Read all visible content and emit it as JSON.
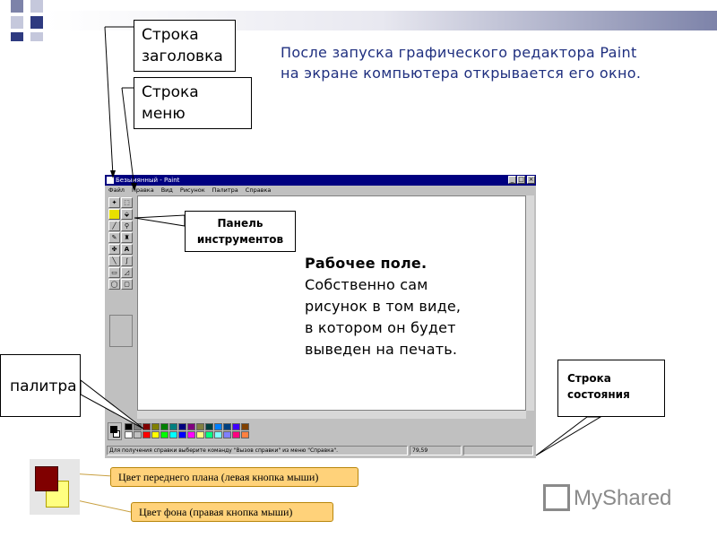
{
  "callouts": {
    "title_bar": "Строка заголовка",
    "menu_bar": "Строка меню",
    "toolbox": "Панель инструментов",
    "palette": "палитра",
    "status_bar": "Строка состояния"
  },
  "intro_text": "После запуска графического редактора Paint на экране компьютера открывается его окно.",
  "work_area": {
    "heading": "Рабочее поле.",
    "body": "Собственно сам рисунок в том виде, в котором он будет выведен на печать."
  },
  "paint_window": {
    "title": "Безымянный - Paint",
    "menu": [
      "Файл",
      "Правка",
      "Вид",
      "Рисунок",
      "Палитра",
      "Справка"
    ],
    "status_message": "Для получения справки выберите команду \"Вызов справки\" из меню \"Справка\".",
    "status_coords": "79,59"
  },
  "colors_legend": {
    "foreground": "Цвет переднего плана (левая кнопка мыши)",
    "background": "Цвет фона (правая кнопка мыши)"
  },
  "logo_text": "MyShared",
  "palette_colors": {
    "row1": [
      "#000000",
      "#808080",
      "#800000",
      "#808000",
      "#008000",
      "#008080",
      "#000080",
      "#800080",
      "#808040",
      "#004040",
      "#0080ff",
      "#004080",
      "#4000ff",
      "#804000"
    ],
    "row2": [
      "#ffffff",
      "#c0c0c0",
      "#ff0000",
      "#ffff00",
      "#00ff00",
      "#00ffff",
      "#0000ff",
      "#ff00ff",
      "#ffff80",
      "#00ff80",
      "#80ffff",
      "#8080ff",
      "#ff0080",
      "#ff8040"
    ]
  },
  "accent_colors": {
    "intro_text": "#1f2f7f",
    "legend_fill": "#ffd27a",
    "foreground_color": "#800000",
    "background_color": "#ffff80"
  }
}
